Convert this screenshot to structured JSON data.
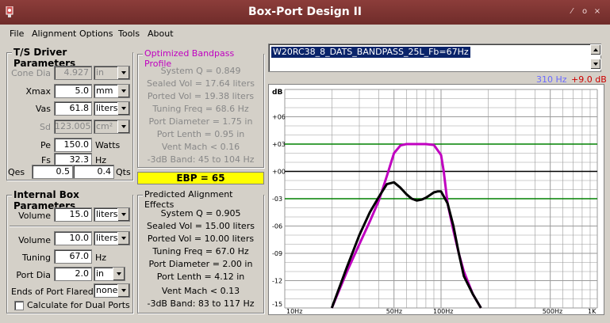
{
  "app": {
    "title": "Box-Port Design II"
  },
  "menu": [
    "File",
    "Alignment",
    "Options",
    "Tools",
    "About"
  ],
  "driver": {
    "title": "T/S Driver Parameters",
    "cone_dia": {
      "label": "Cone Dia",
      "value": "4.927",
      "unit": "in"
    },
    "xmax": {
      "label": "Xmax",
      "value": "5.0",
      "unit": "mm"
    },
    "vas": {
      "label": "Vas",
      "value": "61.8",
      "unit": "liters"
    },
    "sd": {
      "label": "Sd",
      "value": "123.005",
      "unit": "cm²"
    },
    "pe": {
      "label": "Pe",
      "value": "150.0",
      "unit": "Watts"
    },
    "fs": {
      "label": "Fs",
      "value": "32.3",
      "unit": "Hz"
    },
    "qes": {
      "label": "Qes",
      "value": "0.5"
    },
    "qts": {
      "label": "Qts",
      "value": "0.4"
    }
  },
  "optimized": {
    "title": "Optimized Bandpass Profile",
    "lines": [
      "System Q = 0.849",
      "Sealed Vol = 17.64 liters",
      "Ported Vol = 19.38 liters",
      "Tuning Freq = 68.6 Hz",
      "Port Diameter = 1.75 in",
      "Port Lenth = 0.95 in",
      "Vent Mach < 0.16",
      "-3dB Band: 45 to 104 Hz"
    ]
  },
  "ebp": {
    "label": "EBP",
    "value": "= 65"
  },
  "box": {
    "title": "Internal Box Parameters",
    "volume1": {
      "label": "Volume",
      "value": "15.0",
      "unit": "liters"
    },
    "volume2": {
      "label": "Volume",
      "value": "10.0",
      "unit": "liters"
    },
    "tuning": {
      "label": "Tuning",
      "value": "67.0",
      "unit": "Hz"
    },
    "port_dia": {
      "label": "Port Dia",
      "value": "2.0",
      "unit": "in"
    },
    "ends_flared": {
      "label": "Ends of Port Flared",
      "value": "none"
    },
    "dual_ports": {
      "label": "Calculate for Dual Ports",
      "checked": false
    }
  },
  "predicted": {
    "title": "Predicted Alignment Effects",
    "lines": [
      "System Q = 0.905",
      "Sealed Vol = 15.00 liters",
      "Ported Vol = 10.00 liters",
      "Tuning Freq = 67.0 Hz",
      "Port Diameter = 2.00 in",
      "Port Lenth = 4.12 in",
      "Vent Mach < 0.13",
      "-3dB Band: 83 to 117 Hz"
    ]
  },
  "project_name": "W20RC38_8_DATS_BANDPASS_25L_Fb=67Hz",
  "marker": {
    "freq": "310 Hz",
    "level": "+9.0 dB",
    "freq_color": "#6a6aff",
    "level_color": "#cc0000"
  },
  "colors": {
    "optimized_curve": "#c000c0",
    "predicted_curve": "#000000",
    "ref_lines": "#008000"
  },
  "chart_data": {
    "type": "line",
    "ylabel": "dB",
    "x_scale": "log",
    "xlim": [
      10,
      1000
    ],
    "ylim": [
      -15,
      9
    ],
    "y_ticks": [
      "+06",
      "+03",
      "+00",
      "-03",
      "-06",
      "-09",
      "-12",
      "-15"
    ],
    "y_tick_values": [
      6,
      3,
      0,
      -3,
      -6,
      -9,
      -12,
      -15
    ],
    "x_ticks": [
      "10Hz",
      "50Hz",
      "100Hz",
      "500Hz",
      "1K"
    ],
    "x_tick_values": [
      10,
      50,
      100,
      500,
      1000
    ],
    "reference_lines": [
      3,
      0,
      -3
    ],
    "series": [
      {
        "x": [
          20,
          25,
          30,
          35,
          40,
          45,
          50,
          55,
          60,
          65,
          70,
          80,
          90,
          100,
          104,
          110,
          120,
          130,
          140,
          160,
          180
        ],
        "y": [
          -15,
          -11,
          -8,
          -5.5,
          -3.2,
          -0.5,
          2.0,
          2.85,
          3.0,
          3.0,
          3.0,
          3.0,
          2.9,
          1.8,
          0,
          -3.5,
          -6.5,
          -9,
          -11,
          -13.5,
          -15
        ]
      },
      {
        "x": [
          20,
          25,
          30,
          35,
          40,
          45,
          50,
          55,
          60,
          65,
          70,
          75,
          80,
          85,
          90,
          95,
          100,
          110,
          120,
          130,
          140,
          160,
          180
        ],
        "y": [
          -15,
          -10.5,
          -7,
          -4.5,
          -2.8,
          -1.4,
          -1.2,
          -1.8,
          -2.5,
          -3.0,
          -3.2,
          -3.1,
          -2.9,
          -2.6,
          -2.3,
          -2.2,
          -2.2,
          -3.5,
          -6,
          -9,
          -11.5,
          -13.5,
          -15
        ]
      }
    ]
  }
}
